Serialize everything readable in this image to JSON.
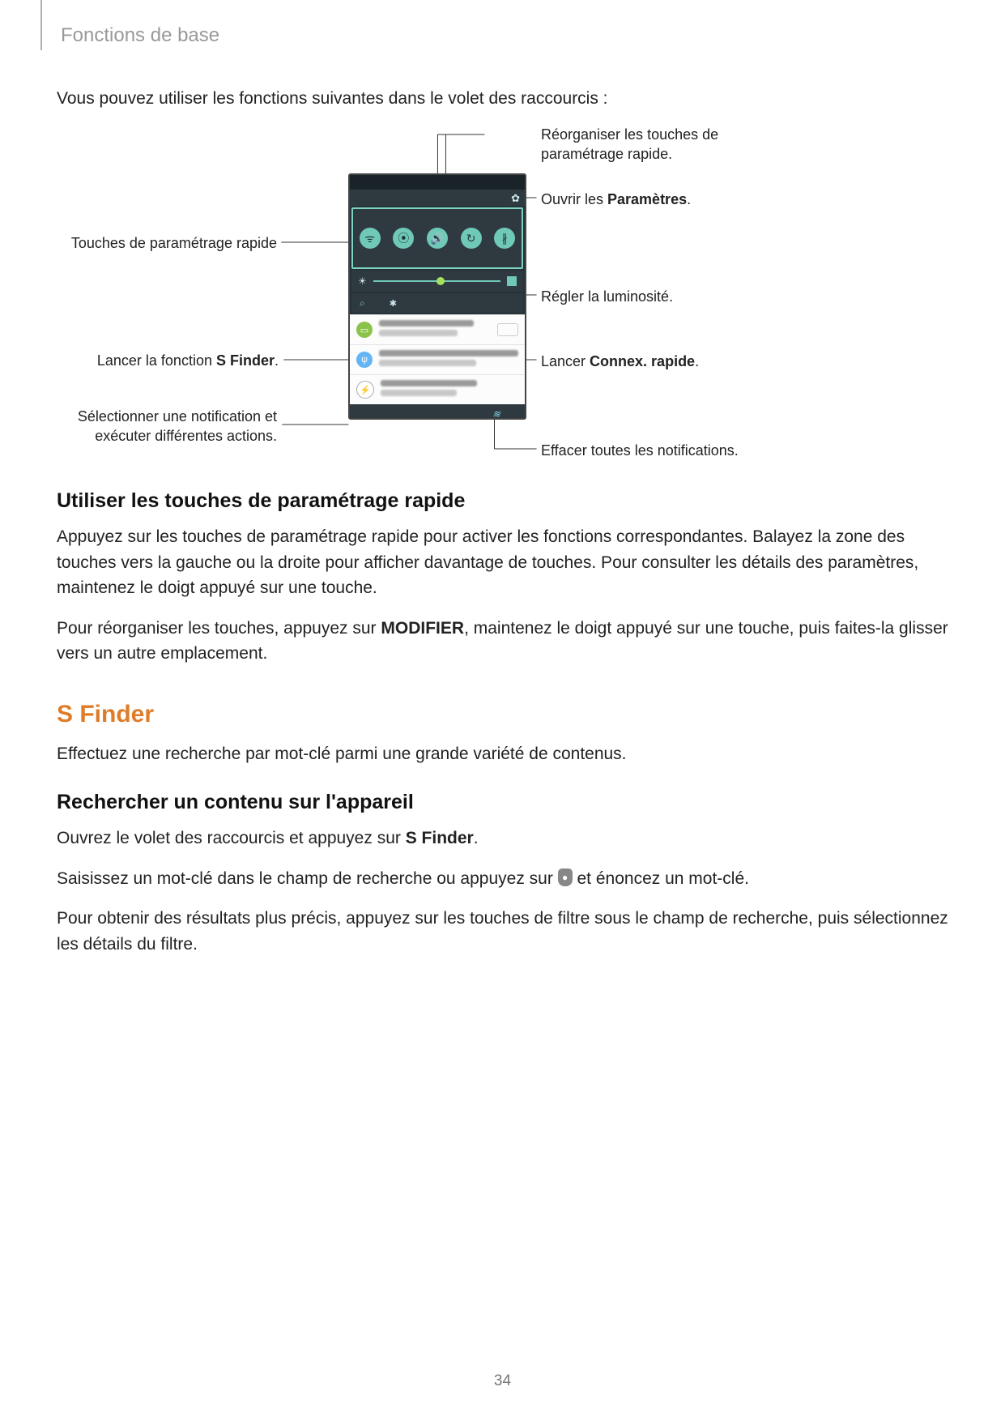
{
  "header": {
    "breadcrumb": "Fonctions de base"
  },
  "intro": "Vous pouvez utiliser les fonctions suivantes dans le volet des raccourcis :",
  "callouts": {
    "quick_settings_keys": "Touches de paramétrage rapide",
    "launch_sfinder_pre": "Lancer la fonction ",
    "launch_sfinder_bold": "S Finder",
    "launch_sfinder_post": ".",
    "select_notification": "Sélectionner une notification et exécuter différentes actions.",
    "reorganize": "Réorganiser les touches de paramétrage rapide.",
    "open_settings_pre": "Ouvrir les ",
    "open_settings_bold": "Paramètres",
    "open_settings_post": ".",
    "adjust_brightness": "Régler la luminosité.",
    "launch_quick_pre": "Lancer ",
    "launch_quick_bold": "Connex. rapide",
    "launch_quick_post": ".",
    "clear_notifications": "Effacer toutes les notifications."
  },
  "section_quick": {
    "heading": "Utiliser les touches de paramétrage rapide",
    "p1": "Appuyez sur les touches de paramétrage rapide pour activer les fonctions correspondantes. Balayez la zone des touches vers la gauche ou la droite pour afficher davantage de touches. Pour consulter les détails des paramètres, maintenez le doigt appuyé sur une touche.",
    "p2_pre": "Pour réorganiser les touches, appuyez sur ",
    "p2_bold": "MODIFIER",
    "p2_post": ", maintenez le doigt appuyé sur une touche, puis faites-la glisser vers un autre emplacement."
  },
  "section_sfinder": {
    "heading": "S Finder",
    "p1": "Effectuez une recherche par mot-clé parmi une grande variété de contenus."
  },
  "section_search": {
    "heading": "Rechercher un contenu sur l'appareil",
    "p1_pre": "Ouvrez le volet des raccourcis et appuyez sur ",
    "p1_bold": "S Finder",
    "p1_post": ".",
    "p2_pre": "Saisissez un mot-clé dans le champ de recherche ou appuyez sur ",
    "p2_post": " et énoncez un mot-clé.",
    "p3": "Pour obtenir des résultats plus précis, appuyez sur les touches de filtre sous le champ de recherche, puis sélectionnez les détails du filtre."
  },
  "page_number": "34",
  "icons": {
    "gear": "✿",
    "wifi": "ᯤ",
    "location": "⦿",
    "sound": "🔊",
    "rotate": "↻",
    "bluetooth": "∦",
    "brightness": "☀",
    "search": "⌕",
    "star": "✱",
    "image": "▭",
    "usb": "ψ",
    "bolt": "⚡",
    "clear": "≋",
    "mic": "●"
  }
}
